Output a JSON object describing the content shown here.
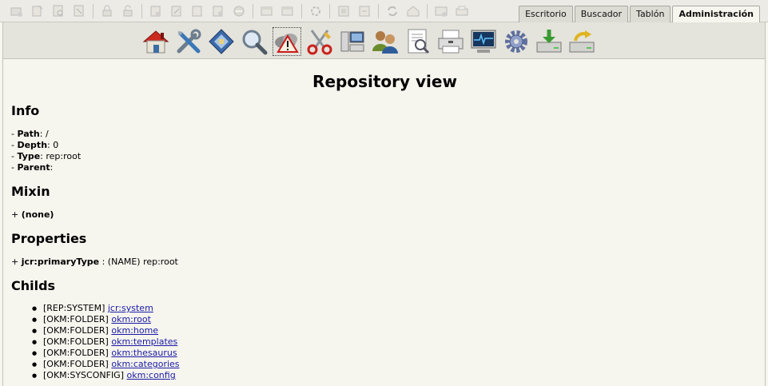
{
  "tabs": [
    {
      "label": "Escritorio",
      "active": false
    },
    {
      "label": "Buscador",
      "active": false
    },
    {
      "label": "Tablón",
      "active": false
    },
    {
      "label": "Administración",
      "active": true
    }
  ],
  "toolbar_icons": [
    "new-folder-icon",
    "add-document-icon",
    "find-folder-icon",
    "find-document-icon",
    "lock-icon",
    "unlock-icon",
    "download-icon",
    "edit-icon",
    "checkin-icon",
    "checkout-icon",
    "cancel-checkout-icon",
    "add-property-group-icon",
    "remove-property-group-icon",
    "workflow-icon",
    "subscribe-icon",
    "unsubscribe-icon",
    "refresh-icon",
    "home-icon",
    "scanner-icon",
    "uploader-icon"
  ],
  "admin_icons": [
    "home-icon",
    "tools-icon",
    "diamond-icon",
    "search-icon",
    "warning-icon",
    "scissors-icon",
    "computers-icon",
    "users-icon",
    "report-icon",
    "printer-icon",
    "monitor-icon",
    "gear-icon",
    "import-icon",
    "export-icon"
  ],
  "page": {
    "title": "Repository view",
    "info": {
      "heading": "Info",
      "path_label": "Path",
      "path_value": ": /",
      "depth_label": "Depth",
      "depth_value": ": 0",
      "type_label": "Type",
      "type_value": ": rep:root",
      "parent_label": "Parent",
      "parent_value": ":"
    },
    "mixin": {
      "heading": "Mixin",
      "value": "(none)"
    },
    "properties": {
      "heading": "Properties",
      "name": "jcr:primaryType",
      "value": " : (NAME) rep:root"
    },
    "childs": {
      "heading": "Childs",
      "items": [
        {
          "type": "[REP:SYSTEM]",
          "name": "jcr:system"
        },
        {
          "type": "[OKM:FOLDER]",
          "name": "okm:root"
        },
        {
          "type": "[OKM:FOLDER]",
          "name": "okm:home"
        },
        {
          "type": "[OKM:FOLDER]",
          "name": "okm:templates"
        },
        {
          "type": "[OKM:FOLDER]",
          "name": "okm:thesaurus"
        },
        {
          "type": "[OKM:FOLDER]",
          "name": "okm:categories"
        },
        {
          "type": "[OKM:SYSCONFIG]",
          "name": "okm:config"
        }
      ]
    }
  }
}
